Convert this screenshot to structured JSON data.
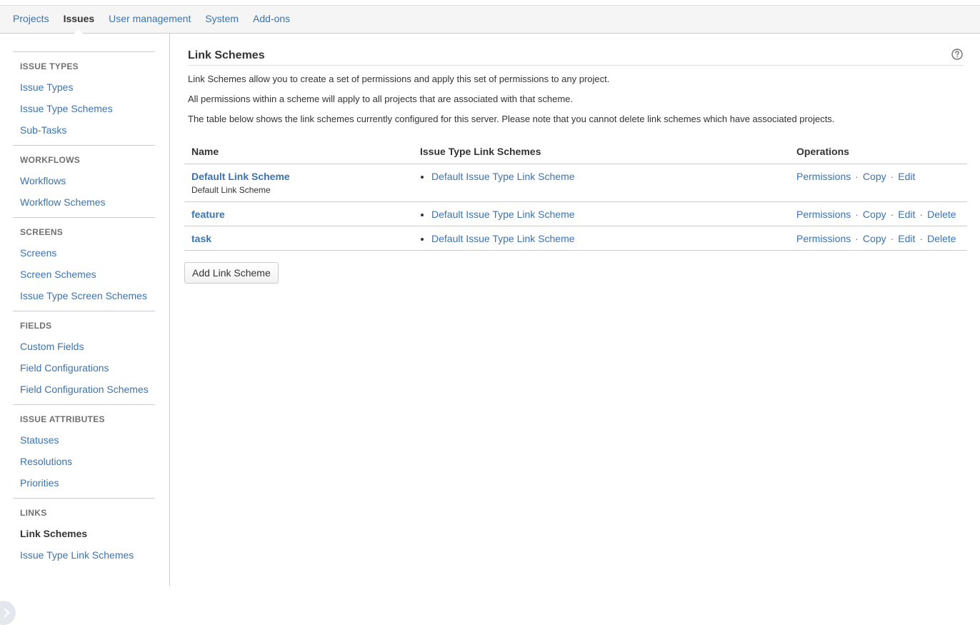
{
  "topnav": {
    "items": [
      {
        "label": "Projects",
        "active": false
      },
      {
        "label": "Issues",
        "active": true
      },
      {
        "label": "User management",
        "active": false
      },
      {
        "label": "System",
        "active": false
      },
      {
        "label": "Add-ons",
        "active": false
      }
    ]
  },
  "sidebar": {
    "sections": [
      {
        "heading": "ISSUE TYPES",
        "items": [
          "Issue Types",
          "Issue Type Schemes",
          "Sub-Tasks"
        ]
      },
      {
        "heading": "WORKFLOWS",
        "items": [
          "Workflows",
          "Workflow Schemes"
        ]
      },
      {
        "heading": "SCREENS",
        "items": [
          "Screens",
          "Screen Schemes",
          "Issue Type Screen Schemes"
        ]
      },
      {
        "heading": "FIELDS",
        "items": [
          "Custom Fields",
          "Field Configurations",
          "Field Configuration Schemes"
        ]
      },
      {
        "heading": "ISSUE ATTRIBUTES",
        "items": [
          "Statuses",
          "Resolutions",
          "Priorities"
        ]
      },
      {
        "heading": "LINKS",
        "items": [
          "Link Schemes",
          "Issue Type Link Schemes"
        ]
      }
    ],
    "selected_item": "Link Schemes"
  },
  "main": {
    "title": "Link Schemes",
    "description": [
      "Link Schemes allow you to create a set of permissions and apply this set of permissions to any project.",
      "All permissions within a scheme will apply to all projects that are associated with that scheme.",
      "The table below shows the link schemes currently configured for this server. Please note that you cannot delete link schemes which have associated projects."
    ],
    "table": {
      "headers": [
        "Name",
        "Issue Type Link Schemes",
        "Operations"
      ],
      "rows": [
        {
          "name": "Default Link Scheme",
          "description": "Default Link Scheme",
          "types": [
            "Default Issue Type Link Scheme"
          ],
          "operations": [
            "Permissions",
            "Copy",
            "Edit"
          ]
        },
        {
          "name": "feature",
          "description": "",
          "types": [
            "Default Issue Type Link Scheme"
          ],
          "operations": [
            "Permissions",
            "Copy",
            "Edit",
            "Delete"
          ]
        },
        {
          "name": "task",
          "description": "",
          "types": [
            "Default Issue Type Link Scheme"
          ],
          "operations": [
            "Permissions",
            "Copy",
            "Edit",
            "Delete"
          ]
        }
      ]
    },
    "add_button_label": "Add Link Scheme"
  },
  "icons": {
    "help": "help-icon",
    "collapse": "chevron-right-icon"
  },
  "colors": {
    "link": "#3b73af",
    "text": "#333333",
    "heading_muted": "#707070",
    "border": "#cccccc",
    "topnav_bg": "#f5f5f5"
  }
}
